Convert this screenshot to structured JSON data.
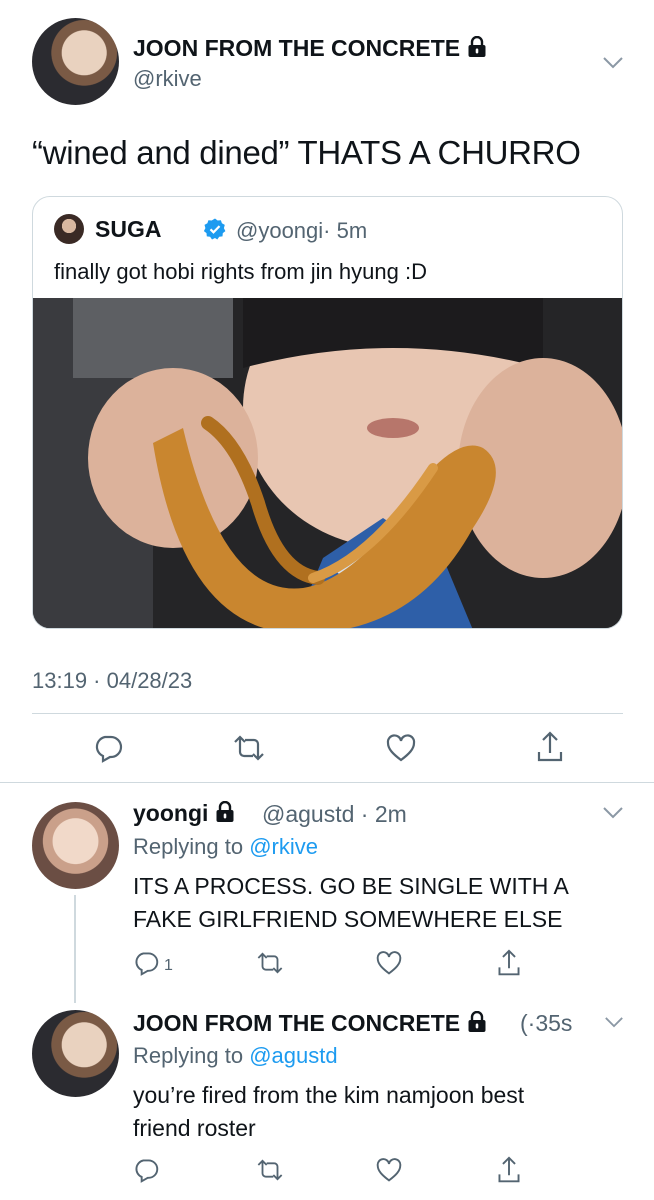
{
  "tweet": {
    "author_name": "JOON FROM THE CONCRETE",
    "author_handle": "@rkive",
    "text": "“wined and dined” THATS A CHURRO",
    "timestamp": "13:19 · 04/28/23"
  },
  "quote": {
    "author_name": "SUGA",
    "author_handle": "@yoongi",
    "time": "· 5m",
    "text": "finally got hobi rights from jin hyung :D",
    "photo_icon": "photo-churro"
  },
  "replies": [
    {
      "author_name": "yoongi",
      "author_handle": "@agustd",
      "time": "· 2m",
      "replying_label": "Replying to",
      "replying_to": "@rkive",
      "text_line1": "ITS A PROCESS. GO BE SINGLE WITH A",
      "text_line2": "FAKE GIRLFRIEND SOMEWHERE ELSE",
      "reply_count": "1"
    },
    {
      "author_name": "JOON FROM THE CONCRETE",
      "author_handle": "(·",
      "time": "35s",
      "replying_label": "Replying to",
      "replying_to": "@agustd",
      "text_line1": "you’re fired from the kim namjoon best",
      "text_line2": "friend roster"
    }
  ],
  "colors": {
    "accent": "#1d9bf0",
    "secondary_text": "#536471",
    "border": "#cfd9de"
  }
}
